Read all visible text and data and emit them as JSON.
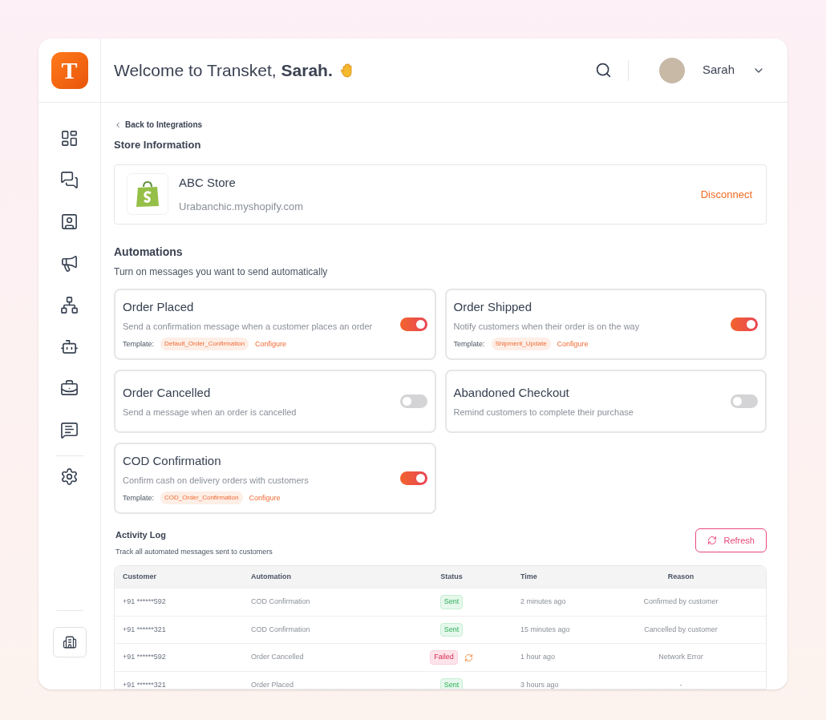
{
  "logo": "T",
  "header": {
    "title": "Welcome to Transket, **Sarah.**",
    "user": "Sarah"
  },
  "back_link": "Back to Integrations",
  "store_section": {
    "title": "Store Information",
    "name": "ABC Store",
    "domain": "Urabanchic.myshopify.com",
    "action": "Disconnect"
  },
  "automations": {
    "title": "Automations",
    "subtitle": "Turn on messages you want to send automatically",
    "items": [
      {
        "title": "Order Placed",
        "description": "Send a confirmation message when a customer places an order",
        "template_label": "Template:",
        "template": "Default_Order_Confirmation",
        "configure": "Configure",
        "on": true
      },
      {
        "title": "Order Shipped",
        "description": "Notify customers when their order is on the way",
        "template_label": "Template:",
        "template": "Shipment_Update",
        "configure": "Configure",
        "on": true
      },
      {
        "title": "Order Cancelled",
        "description": "Send a message when an order is cancelled",
        "on": false
      },
      {
        "title": "Abandoned Checkout",
        "description": "Remind customers to complete their purchase",
        "on": false
      },
      {
        "title": "COD Confirmation",
        "description": "Confirm cash on delivery orders with customers",
        "template_label": "Template:",
        "template": "COD_Order_Confirmation",
        "configure": "Configure",
        "on": true
      }
    ]
  },
  "activity_log": {
    "title": "Activity Log",
    "subtitle": "Track all automated messages sent to customers",
    "refresh": "Refresh",
    "columns": [
      "Customer",
      "Automation",
      "Status",
      "Time",
      "Reason"
    ],
    "rows": [
      {
        "customer": "+91 ******592",
        "automation": "COD Confirmation",
        "status": "Sent",
        "kind": "sent",
        "time": "2 minutes ago",
        "reason": "Confirmed by customer"
      },
      {
        "customer": "+91 ******321",
        "automation": "COD Confirmation",
        "status": "Sent",
        "kind": "sent",
        "time": "15 minutes ago",
        "reason": "Cancelled by customer"
      },
      {
        "customer": "+91 ******592",
        "automation": "Order Cancelled",
        "status": "Failed",
        "kind": "failed",
        "time": "1 hour ago",
        "reason": "Network Error"
      },
      {
        "customer": "+91 ******321",
        "automation": "Order Placed",
        "status": "Sent",
        "kind": "sent",
        "time": "3 hours ago",
        "reason": "-"
      }
    ]
  }
}
